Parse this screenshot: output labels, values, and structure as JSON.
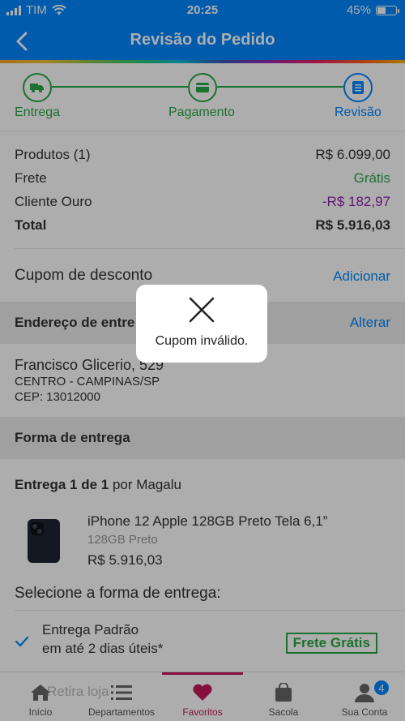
{
  "status": {
    "carrier": "TIM",
    "time": "20:25",
    "battery": "45%",
    "battery_level": 0.45
  },
  "header": {
    "title": "Revisão do Pedido"
  },
  "stepper": {
    "steps": [
      {
        "label": "Entrega"
      },
      {
        "label": "Pagamento"
      },
      {
        "label": "Revisão"
      }
    ]
  },
  "summary": {
    "products_label": "Produtos (1)",
    "products_value": "R$ 6.099,00",
    "shipping_label": "Frete",
    "shipping_value": "Grátis",
    "gold_label": "Cliente Ouro",
    "gold_value": "-R$ 182,97",
    "total_label": "Total",
    "total_value": "R$ 5.916,03"
  },
  "coupon": {
    "label": "Cupom de desconto",
    "action": "Adicionar"
  },
  "address": {
    "section_label": "Endereço de entre",
    "action": "Alterar",
    "street": "Francisco Glicerio, 529",
    "district": "CENTRO - CAMPINAS/SP",
    "cep": "CEP: 13012000"
  },
  "delivery": {
    "section_label": "Forma de entrega",
    "shipment_bold": "Entrega 1 de 1",
    "shipment_rest": " por Magalu",
    "product_name": "iPhone 12 Apple 128GB Preto Tela 6,1”",
    "product_variant": "128GB Preto",
    "product_price": "R$ 5.916,03",
    "select_title": "Selecione a forma de entrega:",
    "option_title": "Entrega Padrão",
    "option_eta": "em até 2 dias úteis*",
    "option_badge": "Frete Grátis",
    "hidden_option": "Retira loja"
  },
  "nav": {
    "items": [
      {
        "label": "Início"
      },
      {
        "label": "Departamentos"
      },
      {
        "label": "Favoritos"
      },
      {
        "label": "Sacola"
      },
      {
        "label": "Sua Conta"
      }
    ],
    "account_badge": "4"
  },
  "toast": {
    "message": "Cupom inválido."
  },
  "colors": {
    "brand": "#0086ff",
    "success": "#28a745",
    "purple": "#8e24aa",
    "favorite": "#c2185b"
  }
}
